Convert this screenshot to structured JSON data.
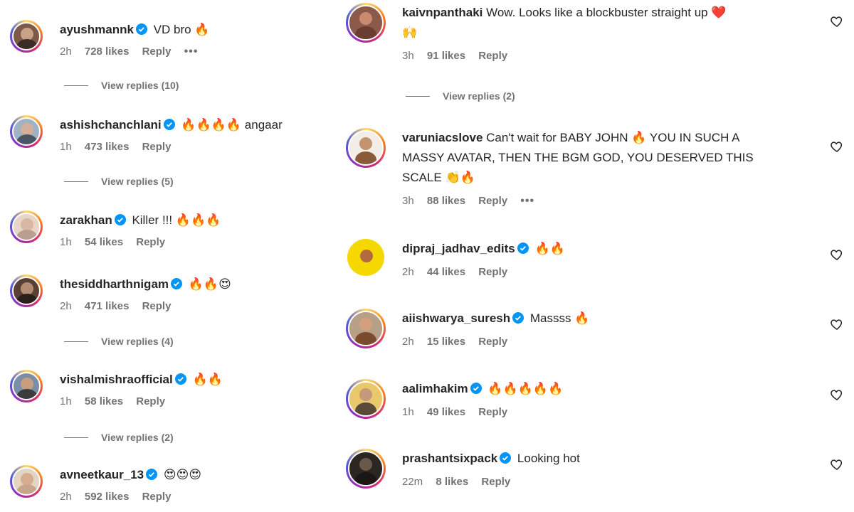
{
  "left": {
    "comments": [
      {
        "username": "ayushmannk",
        "text": "VD bro 🔥",
        "time": "2h",
        "likes": "728 likes",
        "reply": "Reply",
        "more": "•••",
        "view_replies": "View replies (10)"
      },
      {
        "username": "ashishchanchlani",
        "text": "🔥🔥🔥🔥 angaar",
        "time": "1h",
        "likes": "473 likes",
        "reply": "Reply",
        "view_replies": "View replies (5)"
      },
      {
        "username": "zarakhan",
        "text": "Killer !!! 🔥🔥🔥",
        "time": "1h",
        "likes": "54 likes",
        "reply": "Reply"
      },
      {
        "username": "thesiddharthnigam",
        "text": "🔥🔥😍",
        "time": "2h",
        "likes": "471 likes",
        "reply": "Reply",
        "view_replies": "View replies (4)"
      },
      {
        "username": "vishalmishraofficial",
        "text": "🔥🔥",
        "time": "1h",
        "likes": "58 likes",
        "reply": "Reply",
        "view_replies": "View replies (2)"
      },
      {
        "username": "avneetkaur_13",
        "text": "😍😍😍",
        "time": "2h",
        "likes": "592 likes",
        "reply": "Reply"
      }
    ]
  },
  "right": {
    "comments": [
      {
        "username": "kaivnpanthaki",
        "text": "Wow. Looks like a blockbuster straight up ❤️",
        "text2": "🙌",
        "time": "3h",
        "likes": "91 likes",
        "reply": "Reply",
        "view_replies": "View replies (2)"
      },
      {
        "username": "varuniacslove",
        "text": "Can't wait for BABY JOHN 🔥 YOU IN SUCH A",
        "text2": "MASSY AVATAR, THEN THE BGM GOD, YOU DESERVED THIS",
        "text3": "SCALE 👏🔥",
        "time": "3h",
        "likes": "88 likes",
        "reply": "Reply",
        "more": "•••"
      },
      {
        "username": "dipraj_jadhav_edits",
        "text": "🔥🔥",
        "time": "2h",
        "likes": "44 likes",
        "reply": "Reply"
      },
      {
        "username": "aiishwarya_suresh",
        "text": "Massss 🔥",
        "time": "2h",
        "likes": "15 likes",
        "reply": "Reply"
      },
      {
        "username": "aalimhakim",
        "text": "🔥🔥🔥🔥🔥",
        "time": "1h",
        "likes": "49 likes",
        "reply": "Reply"
      },
      {
        "username": "prashantsixpack",
        "text": "Looking hot",
        "time": "22m",
        "likes": "8 likes",
        "reply": "Reply"
      }
    ]
  },
  "colors": {
    "verified": "#0095f6",
    "muted": "#737373",
    "text": "#262626"
  }
}
